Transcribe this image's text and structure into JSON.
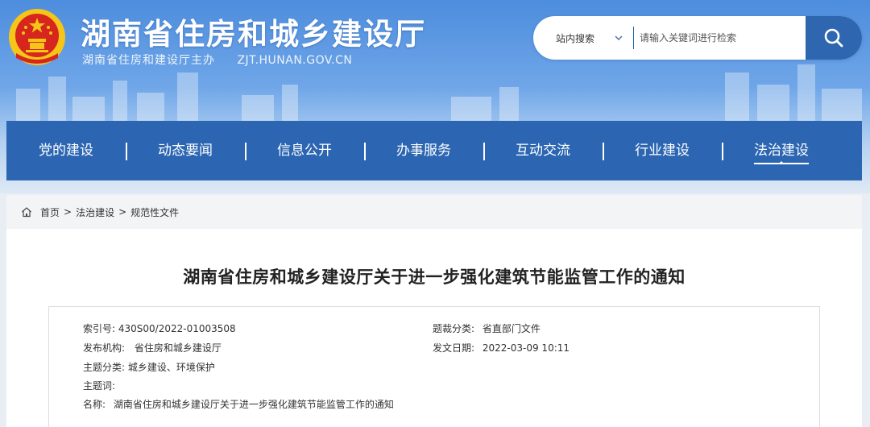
{
  "site": {
    "title": "湖南省住房和城乡建设厅",
    "subtitle": "湖南省住房和建设厅主办",
    "domain": "ZJT.HUNAN.GOV.CN"
  },
  "search": {
    "scope": "站内搜索",
    "placeholder": "请输入关键词进行检索"
  },
  "nav": {
    "items": [
      {
        "label": "党的建设"
      },
      {
        "label": "动态要闻"
      },
      {
        "label": "信息公开"
      },
      {
        "label": "办事服务"
      },
      {
        "label": "互动交流"
      },
      {
        "label": "行业建设"
      },
      {
        "label": "法治建设"
      }
    ],
    "active_index": 6
  },
  "breadcrumb": {
    "items": [
      "首页",
      "法治建设",
      "规范性文件"
    ],
    "separator": ">"
  },
  "document": {
    "title": "湖南省住房和城乡建设厅关于进一步强化建筑节能监管工作的通知",
    "meta": {
      "index_label": "索引号:",
      "index_value": "430S00/2022-01003508",
      "category_label": "题裁分类:",
      "category_value": "省直部门文件",
      "publisher_label": "发布机构:",
      "publisher_value": "省住房和城乡建设厅",
      "date_label": "发文日期:",
      "date_value": "2022-03-09 10:11",
      "topic_label": "主题分类:",
      "topic_value": "城乡建设、环境保护",
      "keywords_label": "主题词:",
      "keywords_value": "",
      "name_label": "名称:",
      "name_value": "湖南省住房和城乡建设厅关于进一步强化建筑节能监管工作的通知"
    }
  },
  "colors": {
    "nav_bg": "#2c66b2",
    "search_btn": "#2e66b0",
    "emblem_red": "#d7261e",
    "emblem_gold": "#f5c518"
  }
}
